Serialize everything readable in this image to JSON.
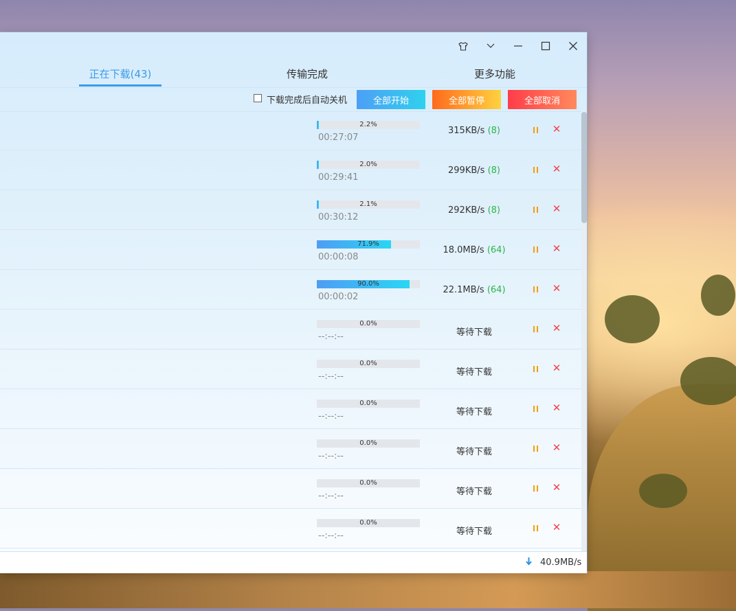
{
  "window": {
    "title_buttons": {
      "skin": "shirt-icon",
      "menu": "chevron-down-icon",
      "minimize": "minimize-icon",
      "maximize": "maximize-icon",
      "close": "close-icon"
    }
  },
  "tabs": [
    {
      "label": "正在下载(43)",
      "active": true
    },
    {
      "label": "传输完成",
      "active": false
    },
    {
      "label": "更多功能",
      "active": false
    }
  ],
  "toolbar": {
    "auto_shutdown_label": "下载完成后自动关机",
    "auto_shutdown_checked": false,
    "start_all": "全部开始",
    "pause_all": "全部暂停",
    "cancel_all": "全部取消"
  },
  "downloads": [
    {
      "progress": "2.2%",
      "time": "00:27:07",
      "speed": "315KB/s",
      "connections": "(8)"
    },
    {
      "progress": "2.0%",
      "time": "00:29:41",
      "speed": "299KB/s",
      "connections": "(8)"
    },
    {
      "progress": "2.1%",
      "time": "00:30:12",
      "speed": "292KB/s",
      "connections": "(8)"
    },
    {
      "progress": "71.9%",
      "time": "00:00:08",
      "speed": "18.0MB/s",
      "connections": "(64)"
    },
    {
      "progress": "90.0%",
      "time": "00:00:02",
      "speed": "22.1MB/s",
      "connections": "(64)"
    },
    {
      "progress": "0.0%",
      "time": "--:--:--",
      "speed": "等待下载",
      "connections": ""
    },
    {
      "progress": "0.0%",
      "time": "--:--:--",
      "speed": "等待下载",
      "connections": ""
    },
    {
      "progress": "0.0%",
      "time": "--:--:--",
      "speed": "等待下载",
      "connections": ""
    },
    {
      "progress": "0.0%",
      "time": "--:--:--",
      "speed": "等待下载",
      "connections": ""
    },
    {
      "progress": "0.0%",
      "time": "--:--:--",
      "speed": "等待下载",
      "connections": ""
    },
    {
      "progress": "0.0%",
      "time": "--:--:--",
      "speed": "等待下载",
      "connections": ""
    }
  ],
  "status": {
    "total_speed": "40.9MB/s",
    "icon": "download-arrow-icon"
  },
  "colors": {
    "accent": "#3c9be8",
    "connections": "#2db34a",
    "pause": "#f39c12",
    "cancel": "#f0454b"
  }
}
